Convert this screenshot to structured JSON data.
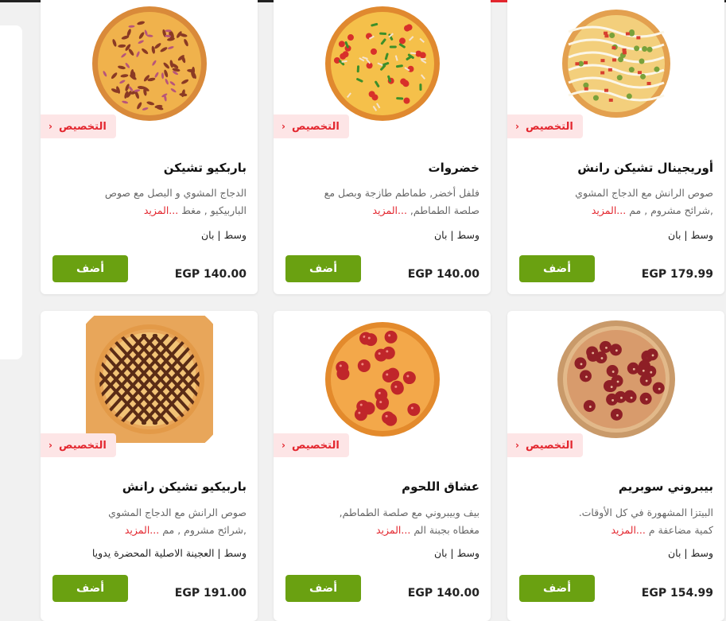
{
  "menu": {
    "customize_label": "التخصيص",
    "add_label": "أضف",
    "more_label": "...المزيد",
    "items": [
      {
        "name": "باربكيو تشيكن",
        "desc_line1": "الدجاج المشوي و البصل مع صوص",
        "desc_line2": "الباربيكيو , مغط",
        "sizes": "وسط | بان",
        "price": "EGP 140.00",
        "pizza_style": "bbq-onion"
      },
      {
        "name": "خضروات",
        "desc_line1": "فلفل أخضر, طماطم طازجة وبصل مع",
        "desc_line2": "صلصة الطماطم,",
        "sizes": "وسط | بان",
        "price": "EGP 140.00",
        "pizza_style": "vegetable"
      },
      {
        "name": "أوريجينال تشيكن رانش",
        "desc_line1": "صوص الرانش مع الدجاج المشوي",
        "desc_line2": ",شرائح مشروم , مم",
        "sizes": "وسط | بان",
        "price": "EGP 179.99",
        "pizza_style": "ranch"
      },
      {
        "name": "باربيكيو تشيكن رانش",
        "desc_line1": "صوص الرانش مع الدجاج المشوي",
        "desc_line2": ",شرائح مشروم , مم",
        "sizes": "وسط | العجينة الاصلية المحضرة يدويا",
        "price": "EGP 191.00",
        "pizza_style": "bbq-lattice"
      },
      {
        "name": "عشاق اللحوم",
        "desc_line1": "بيف وبيبروني مع صلصة الطماطم,",
        "desc_line2": "مغطاه بجبنة الم",
        "sizes": "وسط | بان",
        "price": "EGP 140.00",
        "pizza_style": "pepperoni"
      },
      {
        "name": "بيبروني سوبريم",
        "desc_line1": "البيتزا المشهورة في كل الأوقات.",
        "desc_line2": "كمية مضاعفة م",
        "sizes": "وسط | بان",
        "price": "EGP 154.99",
        "pizza_style": "pepperoni-supreme"
      }
    ]
  },
  "colors": {
    "accent_red": "#e3262e",
    "add_green": "#6aa111",
    "badge_bg": "#fde5e6"
  }
}
